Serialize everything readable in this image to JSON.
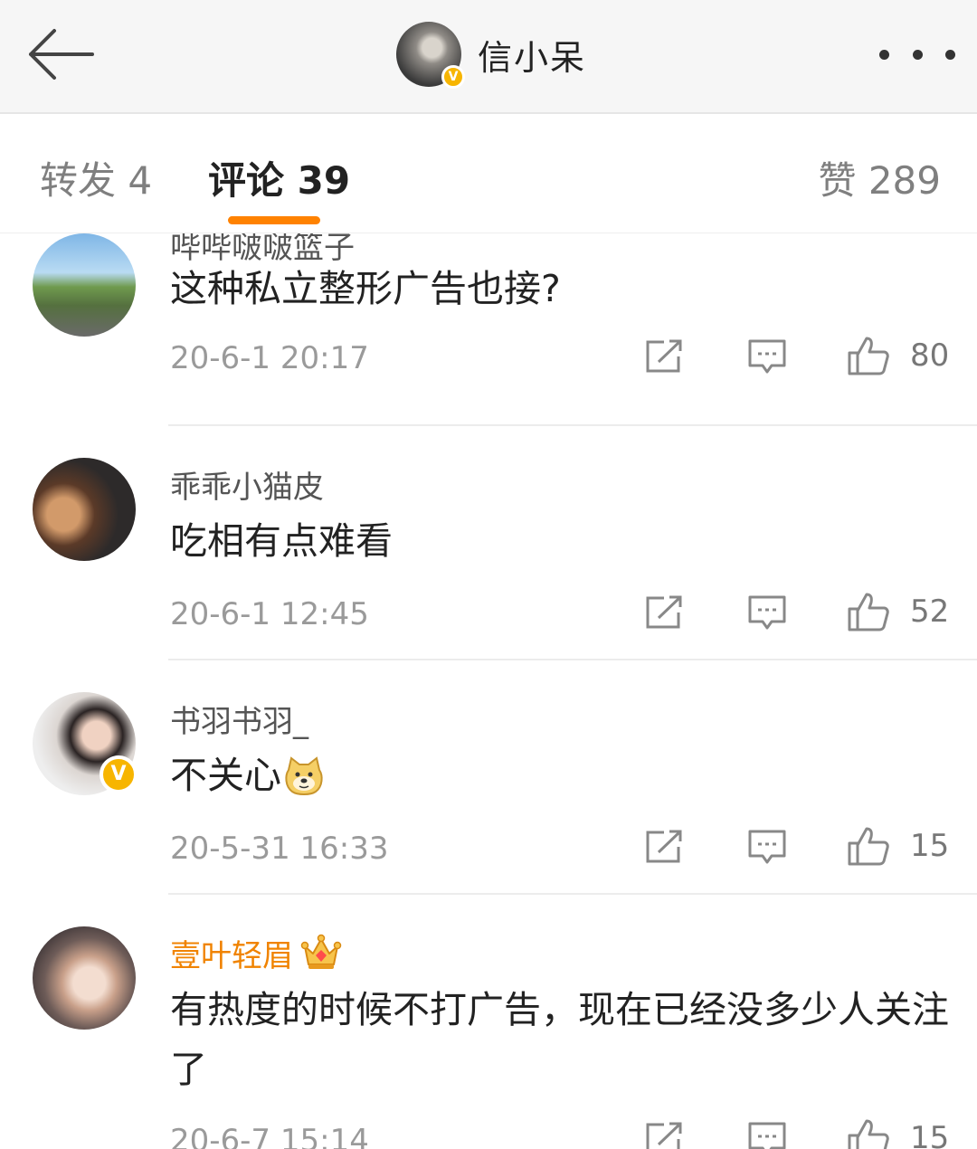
{
  "header": {
    "back_icon": "back-arrow-icon",
    "title": "信小呆",
    "verified_icon": "verified-badge-icon",
    "more_icon": "more-dots-icon"
  },
  "tabs": [
    {
      "label": "转发 4"
    },
    {
      "label": "评论 39",
      "active": true
    },
    {
      "label": "赞 289"
    }
  ],
  "colors": {
    "accent": "#ff8200",
    "vip_name": "#f08300",
    "verified": "#f7b500"
  },
  "comments": [
    {
      "user": "哔哔啵啵篮子",
      "text": "这种私立整形广告也接?",
      "time": "20-6-1 20:17",
      "likes": "80"
    },
    {
      "user": "乖乖小猫皮",
      "text": "吃相有点难看",
      "time": "20-6-1 12:45",
      "likes": "52"
    },
    {
      "user": "书羽书羽_",
      "text": "不关心",
      "emoji": "doge-icon",
      "verified": true,
      "time": "20-5-31 16:33",
      "likes": "15"
    },
    {
      "user": "壹叶轻眉",
      "vip_icon": "crown-icon",
      "text": "有热度的时候不打广告，现在已经没多少人关注了",
      "time": "20-6-7 15:14",
      "likes": "15"
    }
  ]
}
